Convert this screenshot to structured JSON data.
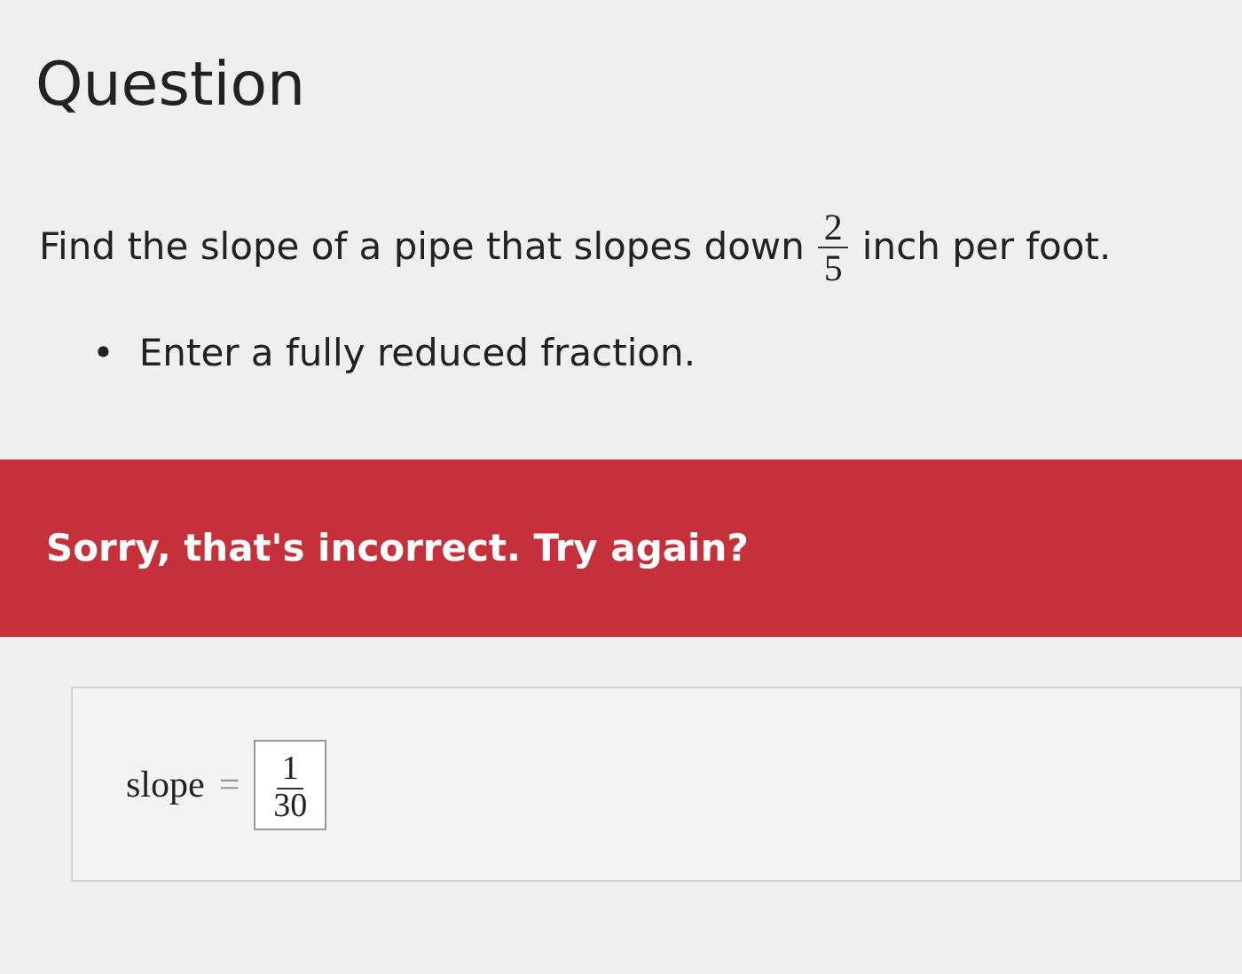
{
  "question": {
    "title": "Question",
    "prompt": {
      "before": "Find the slope of a pipe that slopes down",
      "fraction": {
        "numerator": "2",
        "denominator": "5"
      },
      "after": "inch per foot."
    },
    "instructions": [
      {
        "marker": "•",
        "text": "Enter a fully reduced fraction."
      }
    ]
  },
  "feedback": {
    "kind": "error",
    "text": "Sorry, that's incorrect. Try again?"
  },
  "answer": {
    "label": "slope",
    "operator": "=",
    "fraction": {
      "numerator": "1",
      "denominator": "30"
    }
  }
}
